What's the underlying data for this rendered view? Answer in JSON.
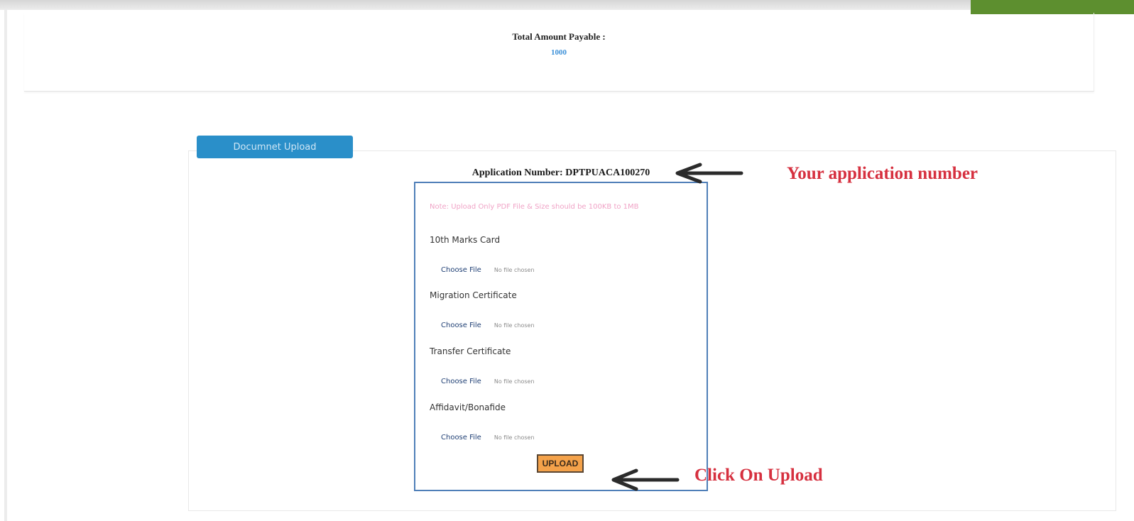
{
  "payment": {
    "label": "Total Amount Payable :",
    "amount": "1000"
  },
  "tab": {
    "label": "Documnet Upload"
  },
  "application": {
    "label": "Application Number: DPTPUACA100270"
  },
  "form": {
    "note": "Note: Upload Only PDF File & Size should be 100KB to 1MB",
    "documents": [
      {
        "label": "10th Marks Card",
        "button": "Choose File",
        "status": "No file chosen"
      },
      {
        "label": "Migration Certificate",
        "button": "Choose File",
        "status": "No file chosen"
      },
      {
        "label": "Transfer Certificate",
        "button": "Choose File",
        "status": "No file chosen"
      },
      {
        "label": "Affidavit/Bonafide",
        "button": "Choose File",
        "status": "No file chosen"
      }
    ],
    "upload_label": "UPLOAD"
  },
  "annotations": {
    "application_number": "Your application number",
    "click_upload": "Click On Upload"
  },
  "colors": {
    "tab_bg": "#2a8fc9",
    "upload_bg": "#f4a24a",
    "annotation_text": "#d6303f",
    "amount_value": "#3a8fd8",
    "form_border": "#4f7fb8"
  },
  "icons": {
    "pointer": "left-arrow-icon"
  }
}
